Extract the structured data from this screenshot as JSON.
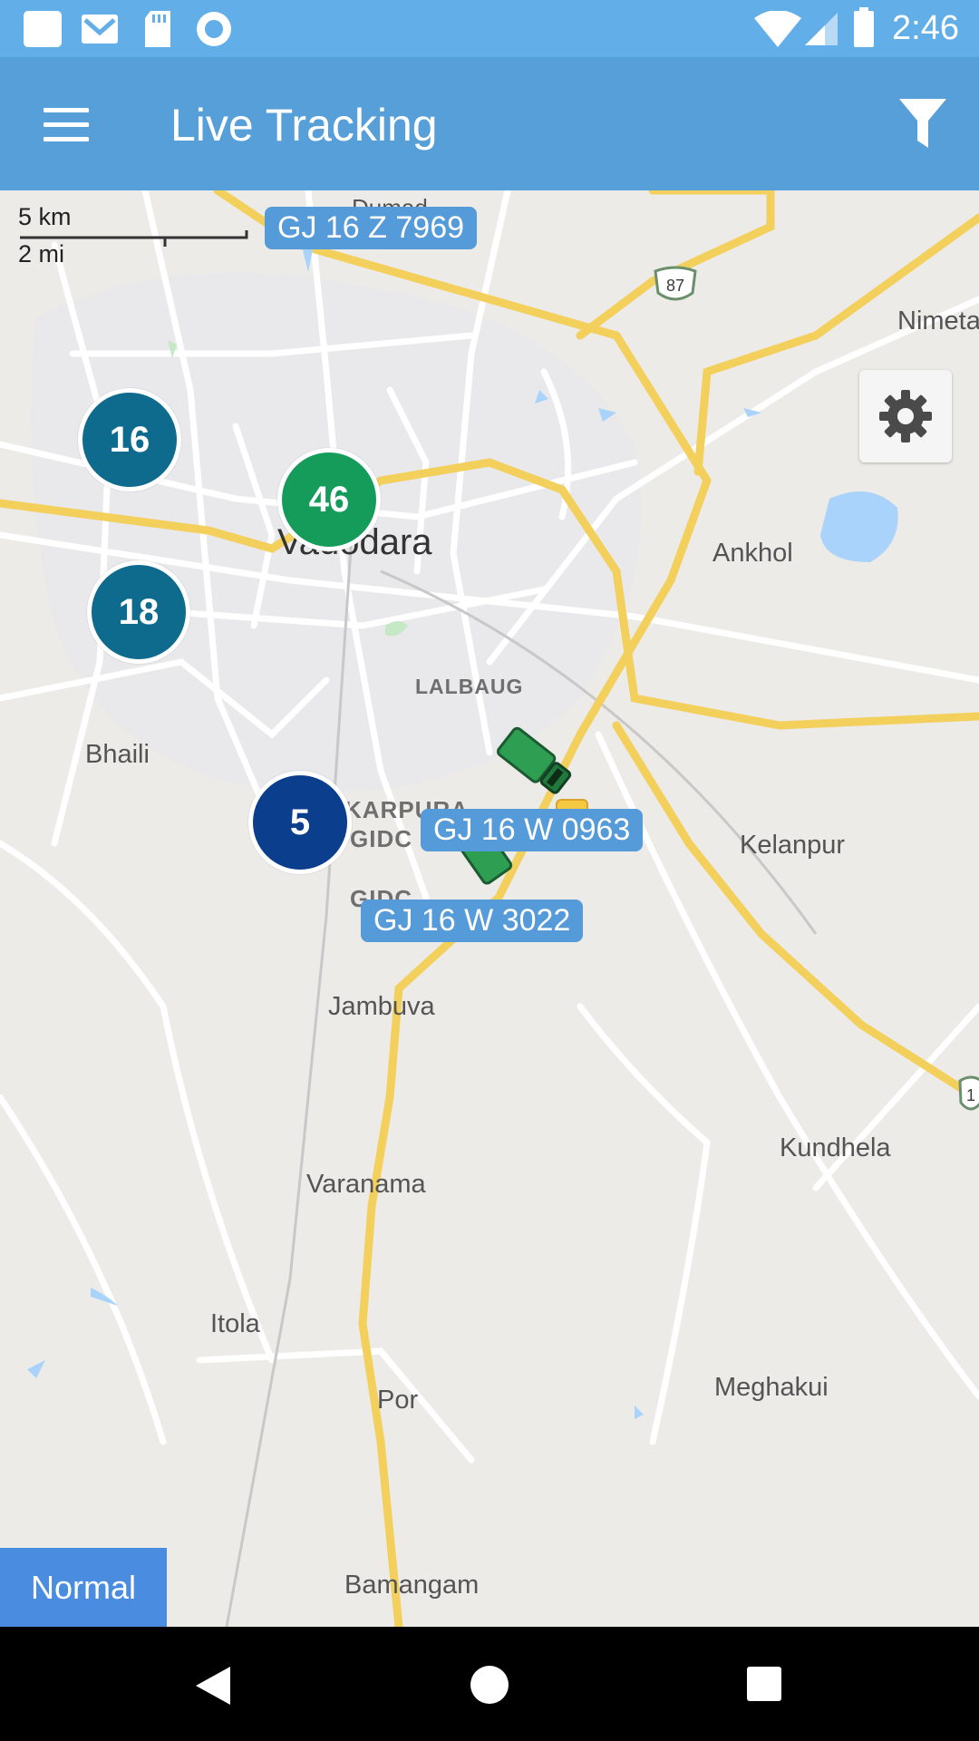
{
  "status_bar": {
    "time": "2:46",
    "icons": [
      "notification-square-icon",
      "gmail-icon",
      "sd-card-icon",
      "sync-icon",
      "wifi-icon",
      "signal-icon",
      "battery-icon"
    ]
  },
  "app_bar": {
    "title": "Live Tracking",
    "menu_icon": "menu-icon",
    "filter_icon": "filter-icon"
  },
  "map": {
    "scale": {
      "km": "5 km",
      "mi": "2 mi"
    },
    "place_labels": {
      "dumad": "Dumad",
      "nimeta": "Nimeta",
      "vadodara": "Vadodara",
      "ankhol": "Ankhol",
      "lalbaug": "LALBAUG",
      "bhaili": "Bhaili",
      "karpura": "KARPURA",
      "karpura_gidc": "GIDC",
      "gidc": "GIDC",
      "kelanpur": "Kelanpur",
      "jambuva": "Jambuva",
      "kundhela": "Kundhela",
      "varanama": "Varanama",
      "itola": "Itola",
      "meghakui": "Meghakui",
      "por": "Por",
      "bamangam": "Bamangam"
    },
    "highway_shields": [
      "87",
      "1"
    ],
    "clusters": [
      {
        "count": "16",
        "color": "#0e6b8d"
      },
      {
        "count": "46",
        "color": "#159c5b"
      },
      {
        "count": "18",
        "color": "#0e6b8d"
      },
      {
        "count": "5",
        "color": "#0b3f8d"
      }
    ],
    "vehicle_labels": [
      "GJ 16 Z 7969",
      "GJ 16 W 0963",
      "GJ 16 W 3022"
    ],
    "settings_icon": "gear-icon",
    "map_type_button": "Normal"
  },
  "nav_bar": {
    "icons": [
      "back-icon",
      "home-icon",
      "recents-icon"
    ]
  }
}
